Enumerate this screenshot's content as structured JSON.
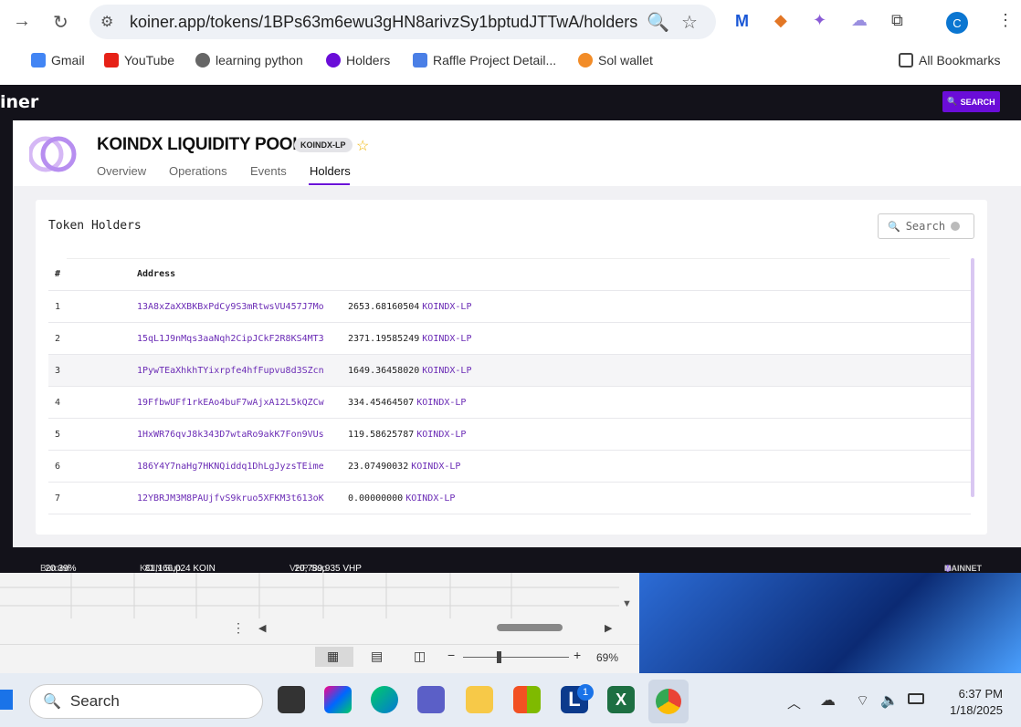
{
  "browser": {
    "url": "koiner.app/tokens/1BPs63m6ewu3gHN8arivzSy1bptudJTTwA/holders",
    "bookmarks": [
      "Gmail",
      "YouTube",
      "learning python",
      "Holders",
      "Raffle Project Detail...",
      "Sol wallet"
    ],
    "all_bookmarks": "All Bookmarks",
    "profile_initial": "C"
  },
  "site": {
    "logo": "iner",
    "search_button": "SEARCH",
    "token_title": "KOINDX LIQUIDITY POOL",
    "token_badge": "KOINDX-LP",
    "tabs": [
      "Overview",
      "Operations",
      "Events",
      "Holders"
    ],
    "active_tab": "Holders",
    "card_title": "Token Holders",
    "search_placeholder": "Search",
    "columns": {
      "num": "#",
      "address": "Address"
    },
    "holders": [
      {
        "num": "1",
        "address": "13A8xZaXXBKBxPdCy9S3mRtwsVU457J7Mo",
        "amount": "2653.68160504",
        "symbol": "KOINDX-LP"
      },
      {
        "num": "2",
        "address": "15qL1J9nMqs3aaNqh2CipJCkF2R8KS4MT3",
        "amount": "2371.19585249",
        "symbol": "KOINDX-LP"
      },
      {
        "num": "3",
        "address": "1PywTEaXhkhTYixrpfe4hfFupvu8d3SZcn",
        "amount": "1649.36458020",
        "symbol": "KOINDX-LP"
      },
      {
        "num": "4",
        "address": "19FfbwUFf1rkEAo4buF7wAjxA12L5kQZCw",
        "amount": "334.45464507",
        "symbol": "KOINDX-LP"
      },
      {
        "num": "5",
        "address": "1HxWR76qvJ8k343D7wtaRo9akK7Fon9VUs",
        "amount": "119.58625787",
        "symbol": "KOINDX-LP"
      },
      {
        "num": "6",
        "address": "186Y4Y7naHg7HKNQiddq1DhLgJyzsTEime",
        "amount": "23.07490032",
        "symbol": "KOINDX-LP"
      },
      {
        "num": "7",
        "address": "12YBRJM3M8PAUjfvS9kruo5XFKM3t613oK",
        "amount": "0.00000000",
        "symbol": "KOINDX-LP"
      }
    ],
    "footer": {
      "burned_label": "Burned",
      "burned_value": "20.39%",
      "koin_label": "KOIN Sup",
      "koin_value": "81,166,024 KOIN",
      "vhp_label": "VHP Sup",
      "vhp_value": "20,789,935 VHP",
      "network": "MAINNET"
    }
  },
  "excel": {
    "zoom": "69%"
  },
  "taskbar": {
    "search": "Search",
    "time": "6:37 PM",
    "date": "1/18/2025",
    "badge_count": "1"
  },
  "colors": {
    "accent": "#6a0dd8",
    "link": "#6a2bb5",
    "dark": "#13121a"
  }
}
